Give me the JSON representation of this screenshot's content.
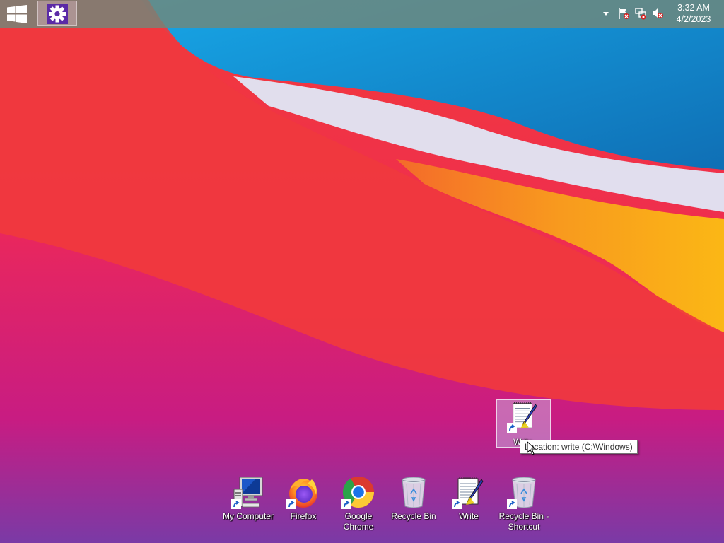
{
  "taskbar": {
    "clock_time": "3:32 AM",
    "clock_date": "4/2/2023",
    "tray_icons": [
      "chevron-up-icon",
      "action-center-flag-icon",
      "network-disconnected-icon",
      "volume-muted-icon"
    ]
  },
  "desktop": {
    "selected_icon_label": "Write",
    "tooltip": "Location: write (C:\\Windows)",
    "icons": [
      {
        "label": "My Computer"
      },
      {
        "label": "Firefox"
      },
      {
        "label": "Google Chrome"
      },
      {
        "label": "Recycle Bin"
      },
      {
        "label": "Write"
      },
      {
        "label": "Recycle Bin - Shortcut"
      }
    ]
  },
  "colors": {
    "taskbar": "#70877a",
    "settings_tile": "#5b2aa6",
    "wallpaper_red": "#f3303f",
    "wallpaper_blue": "#1596d8",
    "wallpaper_orange": "#f9a31d"
  }
}
